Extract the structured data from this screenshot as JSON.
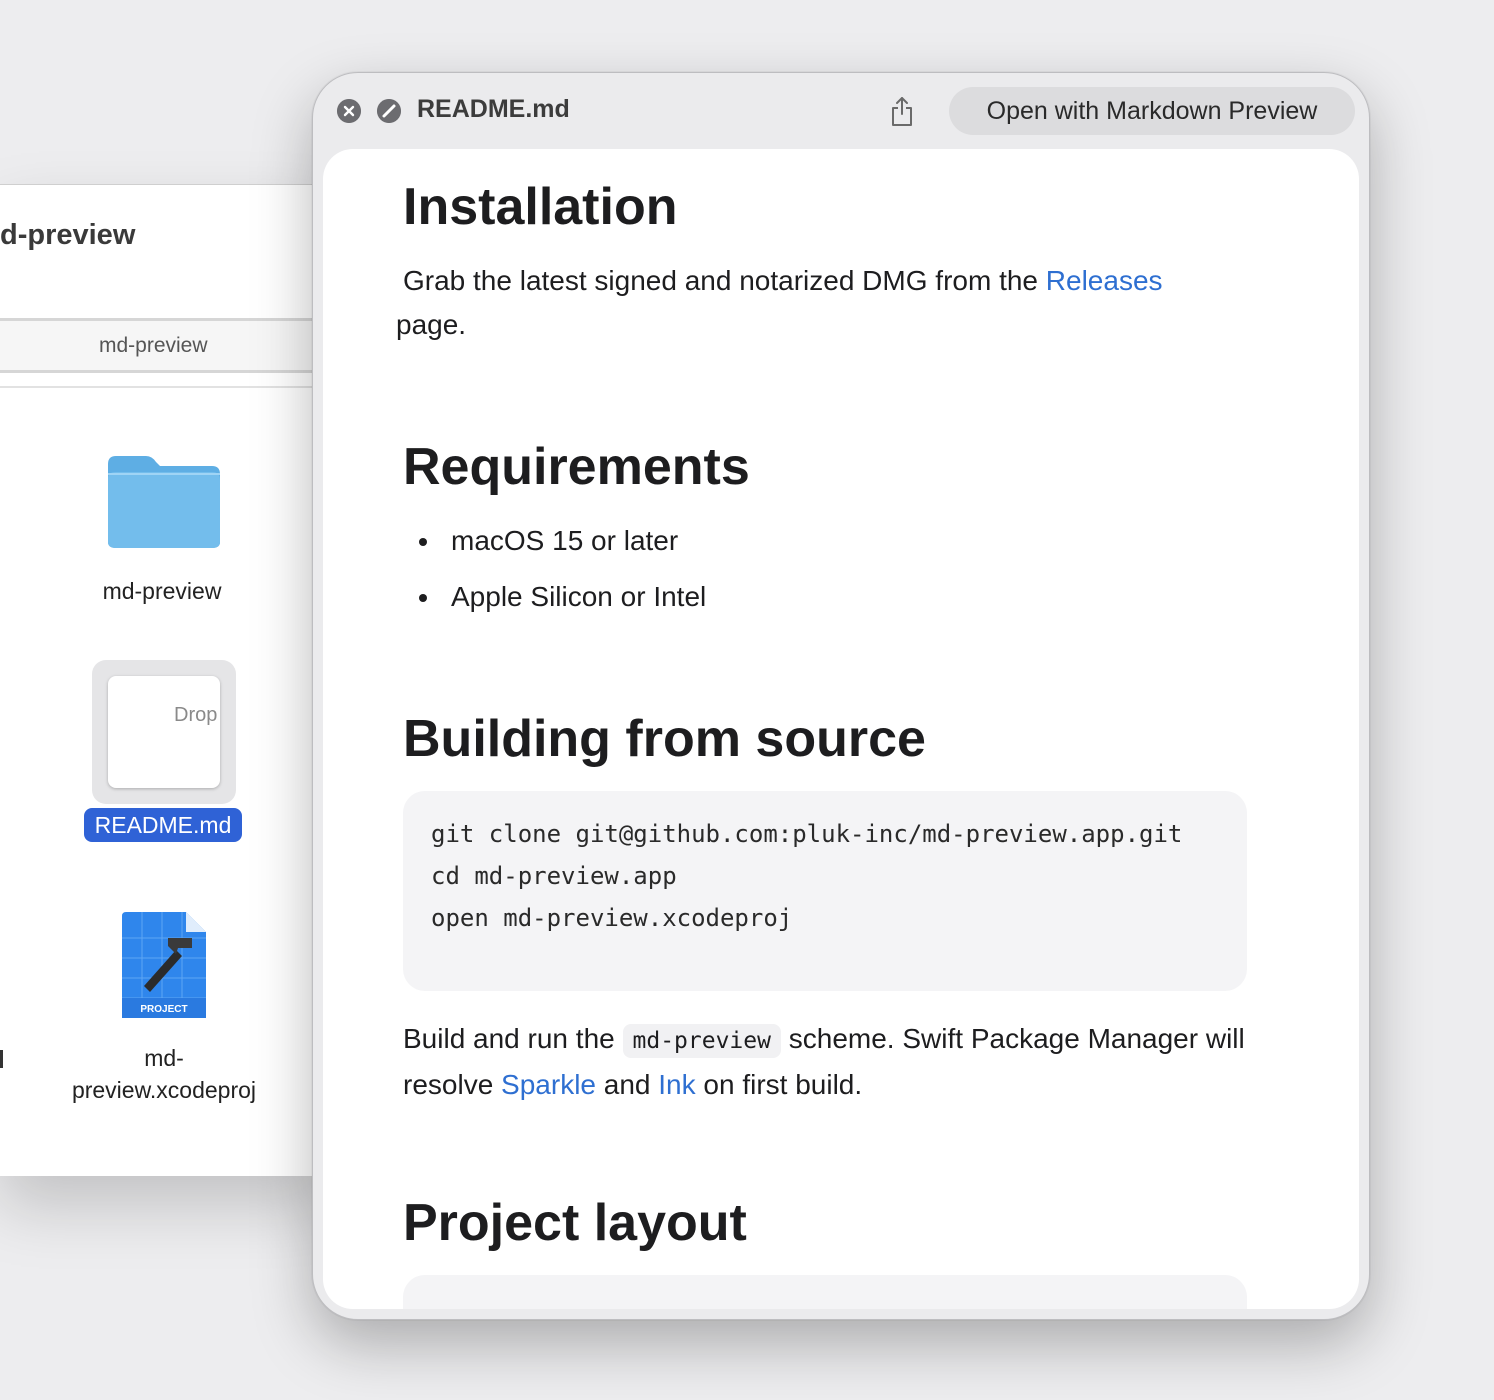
{
  "finder": {
    "title": "d-preview",
    "pathbar": "md-preview",
    "items": [
      {
        "label": "md-preview",
        "kind": "folder"
      },
      {
        "label": "README.md",
        "kind": "markdown",
        "preview_text": "Drop",
        "selected": true
      },
      {
        "label_line1": "md-",
        "label_line2": "preview.xcodeproj",
        "kind": "xcodeproj",
        "badge": "PROJECT"
      }
    ]
  },
  "quicklook": {
    "title": "README.md",
    "open_button": "Open with Markdown Preview",
    "colors": {
      "accent": "#2f62d6",
      "link": "#2e6fd1"
    },
    "content": {
      "installation": {
        "heading": "Installation",
        "text_before": "Grab the latest signed and notarized DMG from the ",
        "link": "Releases",
        "text_after": " page."
      },
      "requirements": {
        "heading": "Requirements",
        "items": [
          "macOS 15 or later",
          "Apple Silicon or Intel"
        ]
      },
      "building": {
        "heading": "Building from source",
        "code": "git clone git@github.com:pluk-inc/md-preview.app.git\ncd md-preview.app\nopen md-preview.xcodeproj",
        "p_start": "Build and run the ",
        "p_code": "md-preview",
        "p_mid": " scheme. Swift Package Manager will resolve ",
        "link1": "Sparkle",
        "p_and": " and ",
        "link2": "Ink",
        "p_end": " on first build."
      },
      "layout": {
        "heading": "Project layout"
      }
    }
  }
}
